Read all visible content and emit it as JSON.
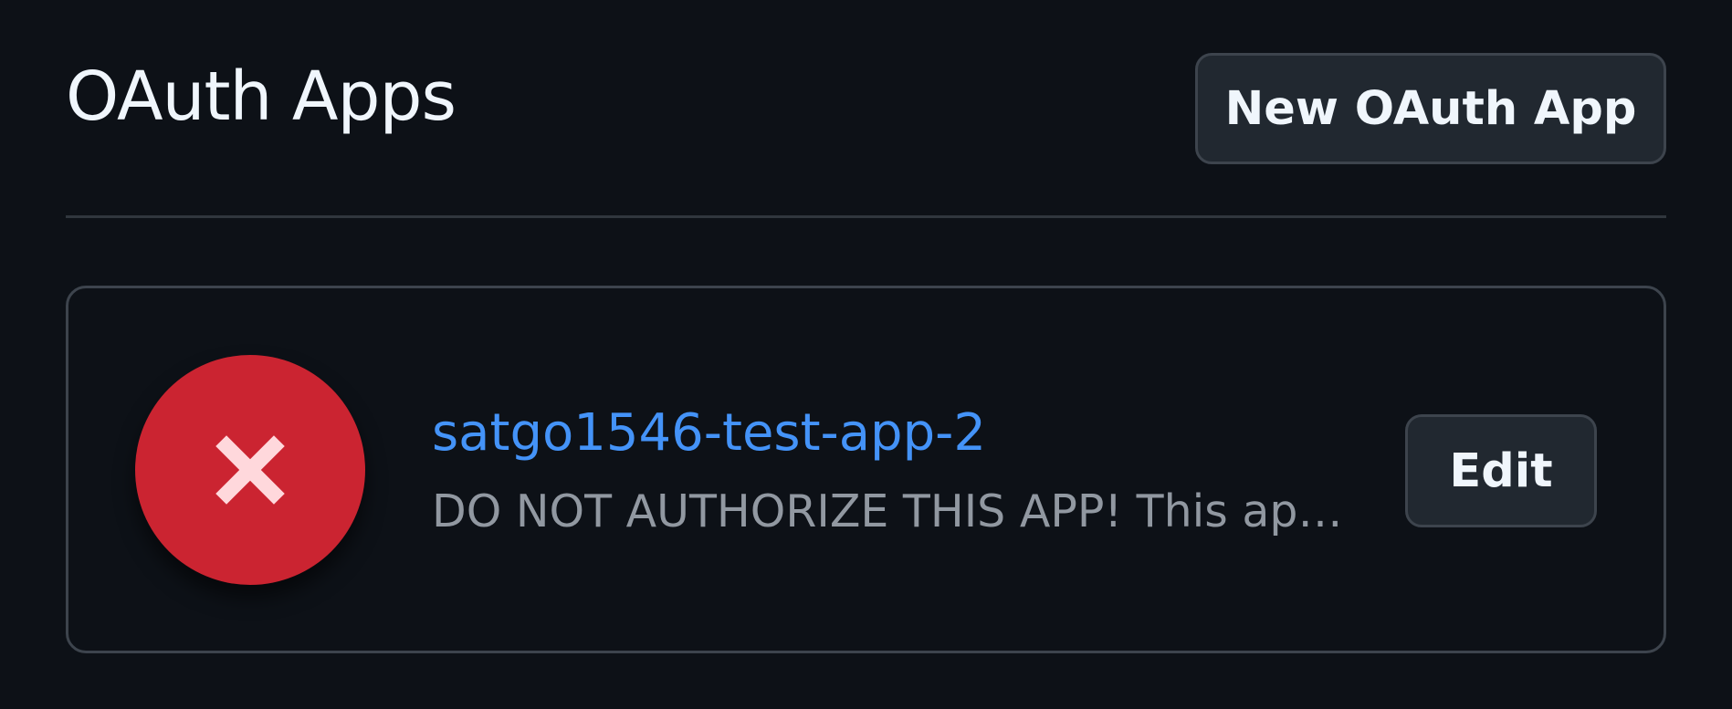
{
  "header": {
    "title": "OAuth Apps",
    "new_button_label": "New OAuth App"
  },
  "apps": [
    {
      "name": "satgo1546-test-app-2",
      "description": "DO NOT AUTHORIZE THIS APP! This app ...",
      "icon": "close-icon",
      "icon_background_color": "#cb2431",
      "icon_foreground_color": "#ffd8dc",
      "edit_label": "Edit"
    }
  ],
  "colors": {
    "background": "#0d1117",
    "link": "#4493f8",
    "muted_text": "#9198a1",
    "border": "#3d444d",
    "button_background": "#212830"
  }
}
